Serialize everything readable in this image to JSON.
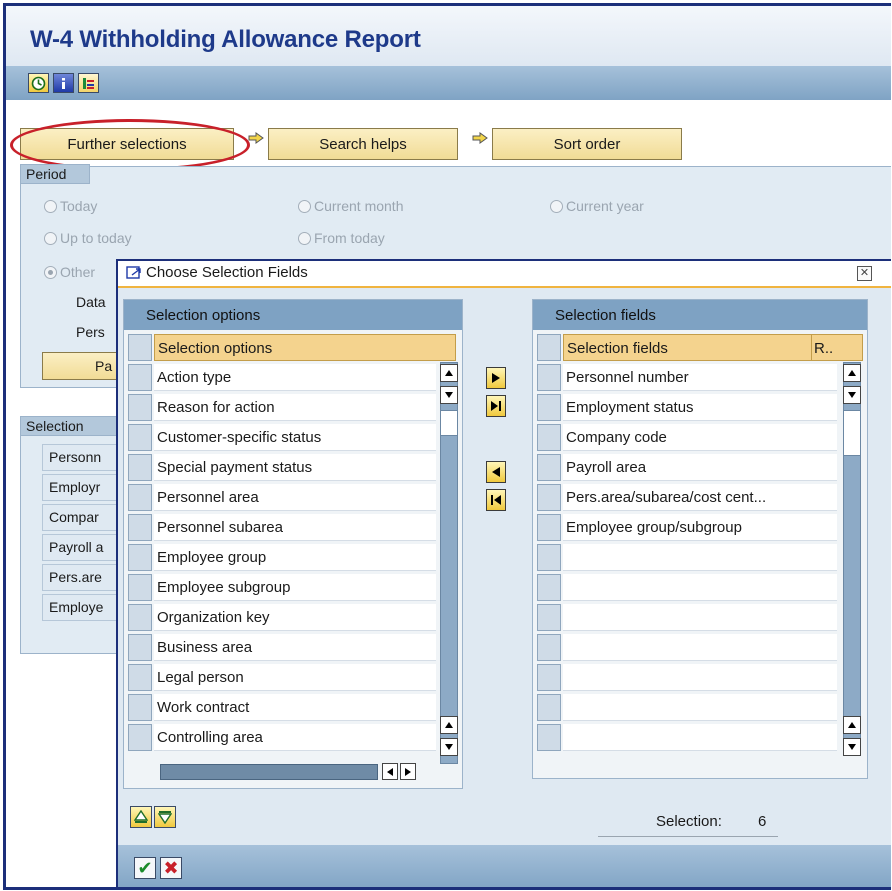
{
  "page": {
    "title": "W-4 Withholding Allowance Report"
  },
  "toolbar": {
    "icons": [
      "execute-clock-icon",
      "information-icon",
      "selection-variants-icon"
    ]
  },
  "tabs": {
    "further_selections": "Further selections",
    "search_helps": "Search helps",
    "sort_order": "Sort order"
  },
  "period": {
    "label": "Period",
    "today": "Today",
    "current_month": "Current month",
    "current_year": "Current year",
    "up_to_today": "Up to today",
    "from_today": "From today",
    "other": "Other",
    "data": "Data",
    "pers": "Pers",
    "pa_button": "Pa"
  },
  "selection_panel": {
    "label": "Selection",
    "fields": [
      "Personn",
      "Employr",
      "Compar",
      "Payroll a",
      "Pers.are",
      "Employe"
    ]
  },
  "dialog": {
    "title": "Choose Selection Fields",
    "left": {
      "header": "Selection options",
      "column_header": "Selection options",
      "items": [
        "Action type",
        "Reason for action",
        "Customer-specific status",
        "Special payment status",
        "Personnel area",
        "Personnel subarea",
        "Employee group",
        "Employee subgroup",
        "Organization key",
        "Business area",
        "Legal person",
        "Work contract",
        "Controlling area"
      ]
    },
    "right": {
      "header": "Selection fields",
      "column_header": "Selection fields",
      "column_header_short": "R..",
      "items": [
        "Personnel number",
        "Employment status",
        "Company code",
        "Payroll area",
        "Pers.area/subarea/cost cent...",
        "Employee group/subgroup"
      ],
      "empty_rows": 7
    },
    "selection_label": "Selection:",
    "selection_count": "6"
  },
  "colors": {
    "title_blue": "#1e3a8a",
    "highlight_red": "#c8202a",
    "tab_yellow": "#f1dc96",
    "toolbar_blue": "#7fa3c4"
  }
}
